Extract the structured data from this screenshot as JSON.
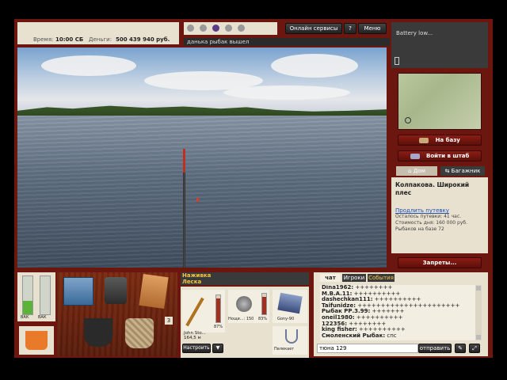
{
  "status_bar": {
    "time_label": "Время:",
    "time_value": "10:00 СБ",
    "money_label": "Деньги:",
    "money_value": "500 439 940 руб."
  },
  "top_menu": {
    "online_services": "Онлайн сервисы",
    "help": "?",
    "menu": "Меню"
  },
  "notification": "данька рыбак вышел",
  "battery": {
    "text": "Battery low..."
  },
  "side_buttons": {
    "to_base": "На базу",
    "to_hq": "Войти в штаб",
    "home_tab": "Дом",
    "trunk_tab": "Багажник"
  },
  "location": {
    "title": "Колпакова. Широкий плес",
    "link": "Продлить путевку",
    "lines": [
      "Осталось путевки: 41 час.",
      "Стоимость дня: 160 000 руб.",
      "Рыбаков на базе 72"
    ]
  },
  "restrictions_button": "Запреты...",
  "gauges": {
    "left_label": "ВАК",
    "right_label": "ВАК",
    "left_level": 0.35,
    "right_level": 0.0
  },
  "tackle_tabs": {
    "bait": "Наживка",
    "line": "Леска"
  },
  "tackle": {
    "rod_name": "John Sto...",
    "rod_length": "164,5 м",
    "rod_percent": "87%",
    "reel_label": "Нощи...: 150",
    "reel_percent": "83%",
    "lure_label": "Gony-90",
    "setup_button": "Настроить",
    "dropdown_arrow": "▼",
    "extra_label": "Пелекает"
  },
  "item_badge": "3",
  "chat_tabs": {
    "chat": "чат",
    "players": "Игроки",
    "events": "События"
  },
  "chat_lines": [
    {
      "name": "Dina1962:",
      "text": " ++++++++"
    },
    {
      "name": "M.B.A.11:",
      "text": " ++++++++++"
    },
    {
      "name": "dashechkan111:",
      "text": " ++++++++++"
    },
    {
      "name": "Taifunidze:",
      "text": " ++++++++++++++++++++++"
    },
    {
      "name": "Рыбак РР.3.99:",
      "text": " +++++++"
    },
    {
      "name": "oneil1980:",
      "text": " ++++++++++"
    },
    {
      "name": "122356:",
      "text": " ++++++++"
    },
    {
      "name": "king fisher:",
      "text": " ++++++++++"
    },
    {
      "name": "Смоленский Рыбак:",
      "text": " спс"
    }
  ],
  "chat_input": {
    "value": "тюна 129"
  },
  "send_button": "отправить"
}
